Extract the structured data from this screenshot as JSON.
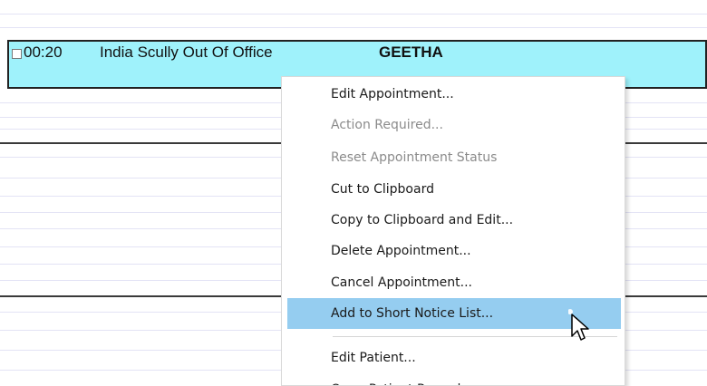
{
  "appointment": {
    "time": "00:20",
    "title": "India Scully Out Of Office",
    "staff": "GEETHA",
    "color": "#9ff2fb"
  },
  "context_menu": {
    "items": [
      {
        "label": "Edit Appointment...",
        "enabled": true
      },
      {
        "label": "Action Required...",
        "enabled": false
      },
      {
        "label": "Reset Appointment Status",
        "enabled": false
      },
      {
        "label": "Cut to Clipboard",
        "enabled": true
      },
      {
        "label": "Copy to Clipboard and Edit...",
        "enabled": true
      },
      {
        "label": "Delete Appointment...",
        "enabled": true
      },
      {
        "label": "Cancel Appointment...",
        "enabled": true
      },
      {
        "label": "Add to Short Notice List...",
        "enabled": true,
        "highlighted": true
      },
      {
        "label": "Edit Patient...",
        "enabled": true
      },
      {
        "label": "Open Patient Record",
        "enabled": true
      }
    ],
    "highlight_color": "#95cdf0"
  },
  "cursor_icon": "arrow-cursor-icon"
}
